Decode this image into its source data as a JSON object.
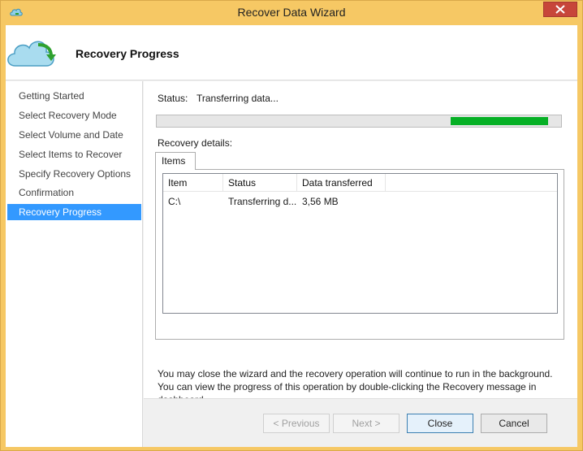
{
  "window": {
    "title": "Recover Data Wizard"
  },
  "header": {
    "title": "Recovery Progress",
    "icon": "cloud-restore-icon"
  },
  "sidebar": {
    "items": [
      {
        "label": "Getting Started",
        "active": false
      },
      {
        "label": "Select Recovery Mode",
        "active": false
      },
      {
        "label": "Select Volume and Date",
        "active": false
      },
      {
        "label": "Select Items to Recover",
        "active": false
      },
      {
        "label": "Specify Recovery Options",
        "active": false
      },
      {
        "label": "Confirmation",
        "active": false
      },
      {
        "label": "Recovery Progress",
        "active": true
      }
    ]
  },
  "status": {
    "label": "Status:",
    "value": "Transferring data...",
    "progress_indeterminate": true,
    "progress_fill_color": "#06b025"
  },
  "details": {
    "label": "Recovery details:",
    "tab_label": "Items",
    "columns": [
      "Item",
      "Status",
      "Data transferred"
    ],
    "rows": [
      [
        "C:\\",
        "Transferring d...",
        "3,56 MB"
      ]
    ]
  },
  "info_text": "You may close the wizard and the recovery operation will continue to run in the background. You can view the progress of this operation by double-clicking the Recovery message in dashboard.",
  "buttons": {
    "previous": "< Previous",
    "next": "Next >",
    "close": "Close",
    "cancel": "Cancel"
  },
  "colors": {
    "titlebar": "#f6c864",
    "selection": "#3399ff",
    "close_button": "#c7463a"
  }
}
